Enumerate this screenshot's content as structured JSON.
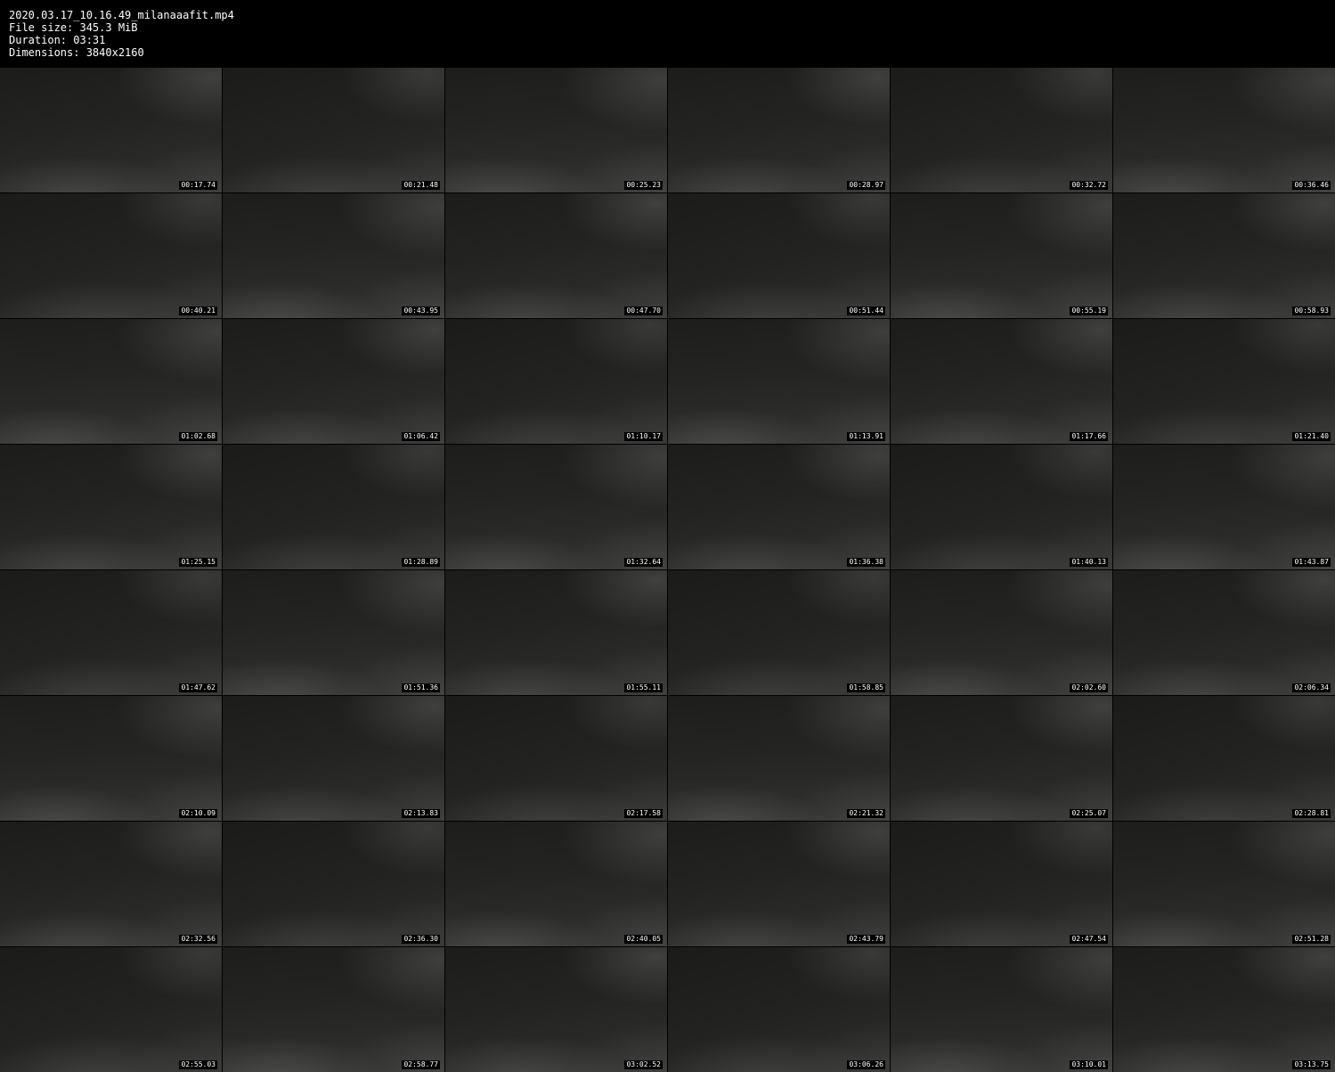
{
  "header": {
    "filename": "2020.03.17_10.16.49_milanaaafit.mp4",
    "file_size": "File size: 345.3 MiB",
    "duration": "Duration: 03:31",
    "dimensions": "Dimensions: 3840x2160"
  },
  "thumbnails": [
    "00:17.74",
    "00:21.48",
    "00:25.23",
    "00:28.97",
    "00:32.72",
    "00:36.46",
    "00:40.21",
    "00:43.95",
    "00:47.70",
    "00:51.44",
    "00:55.19",
    "00:58.93",
    "01:02.68",
    "01:06.42",
    "01:10.17",
    "01:13.91",
    "01:17.66",
    "01:21.40",
    "01:25.15",
    "01:28.89",
    "01:32.64",
    "01:36.38",
    "01:40.13",
    "01:43.87",
    "01:47.62",
    "01:51.36",
    "01:55.11",
    "01:58.85",
    "02:02.60",
    "02:06.34",
    "02:10.09",
    "02:13.83",
    "02:17.58",
    "02:21.32",
    "02:25.07",
    "02:28.81",
    "02:32.56",
    "02:36.30",
    "02:40.05",
    "02:43.79",
    "02:47.54",
    "02:51.28",
    "02:55.03",
    "02:58.77",
    "03:02.52",
    "03:06.26",
    "03:10.01",
    "03:13.75"
  ]
}
